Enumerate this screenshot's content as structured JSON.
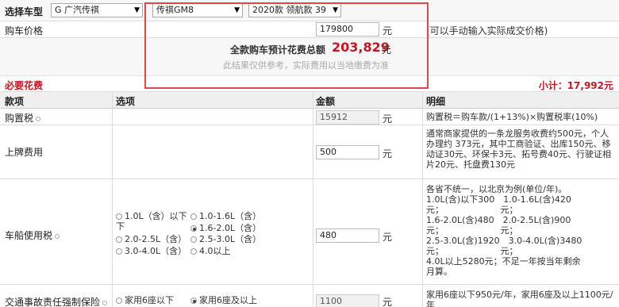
{
  "selector": {
    "label": "选择车型",
    "brand": "G 广汽传祺",
    "model": "传祺GM8",
    "trim": "2020款 领航款 39"
  },
  "price": {
    "label": "购车价格",
    "value": "179800",
    "unit": "元",
    "hint": "(可以手动输入实际成交价格)"
  },
  "total": {
    "label": "全款购车预计花费总额",
    "value": "203,829",
    "unit": "元",
    "note": "此结果仅供参考，实际费用以当地缴费为准"
  },
  "section": {
    "title": "必要花费",
    "subtotal": "小计：17,992元"
  },
  "columns": [
    "款项",
    "选项",
    "金额",
    "明细"
  ],
  "rows": {
    "purchase_tax": {
      "name": "购置税",
      "amount": "15912",
      "unit": "元",
      "detail": "购置税＝购车款/(1+13%)×购置税率(10%)"
    },
    "plate": {
      "name": "上牌费用",
      "amount": "500",
      "unit": "元",
      "detail": "通常商家提供的一条龙服务收费约500元，个人办理约 373元，其中工商验证、出库150元、移动证30元、环保卡3元、拓号费40元、行驶证相片20元、托盘费130元"
    },
    "vessel_tax": {
      "name": "车船使用税",
      "amount": "480",
      "unit": "元",
      "options": [
        "1.0L（含）以下",
        "1.0-1.6L（含）",
        "1.6-2.0L（含）",
        "2.0-2.5L（含）",
        "2.5-3.0L（含）",
        "3.0-4.0L（含）",
        "4.0以上"
      ],
      "detail_lines": [
        "各省不统一，以北京为例(单位/年)。",
        "1.0L(含)以下300　1.0-1.6L(含)420",
        "元；　　　　　　　元；",
        "1.6-2.0L(含)480　2.0-2.5L(含)900",
        "元；　　　　　　　元；",
        "2.5-3.0L(含)1920　3.0-4.0L(含)3480",
        "元；　　　　　　　元；",
        "4.0L以上5280元；不足一年按当年剩余",
        "月算。"
      ]
    },
    "insurance": {
      "name": "交通事故责任强制保险",
      "amount": "1100",
      "unit": "元",
      "options": [
        "家用6座以下",
        "家用6座及以上"
      ],
      "detail": "家用6座以下950元/年，家用6座及以上1100元/年"
    }
  }
}
